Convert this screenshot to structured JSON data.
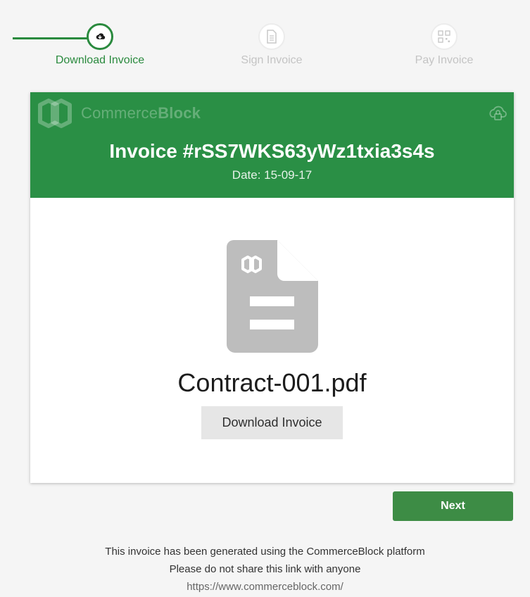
{
  "stepper": {
    "steps": [
      {
        "label": "Download Invoice",
        "icon": "cloud-download-icon",
        "state": "active"
      },
      {
        "label": "Sign Invoice",
        "icon": "document-icon",
        "state": "inactive"
      },
      {
        "label": "Pay Invoice",
        "icon": "qr-code-icon",
        "state": "inactive"
      }
    ]
  },
  "header": {
    "brand_light": "Commerce",
    "brand_bold": "Block",
    "title": "Invoice #rSS7WKS63yWz1txia3s4s",
    "date": "Date: 15-09-17"
  },
  "document": {
    "file_name": "Contract-001.pdf",
    "download_label": "Download Invoice"
  },
  "actions": {
    "next_label": "Next"
  },
  "footer": {
    "line1": "This invoice has been generated using the CommerceBlock platform",
    "line2": "Please do not share this link with anyone",
    "url": "https://www.commerceblock.com/"
  },
  "colors": {
    "brand_green": "#2a8f45",
    "next_green": "#3d8c45",
    "inactive_step": "#c4c4c4"
  }
}
